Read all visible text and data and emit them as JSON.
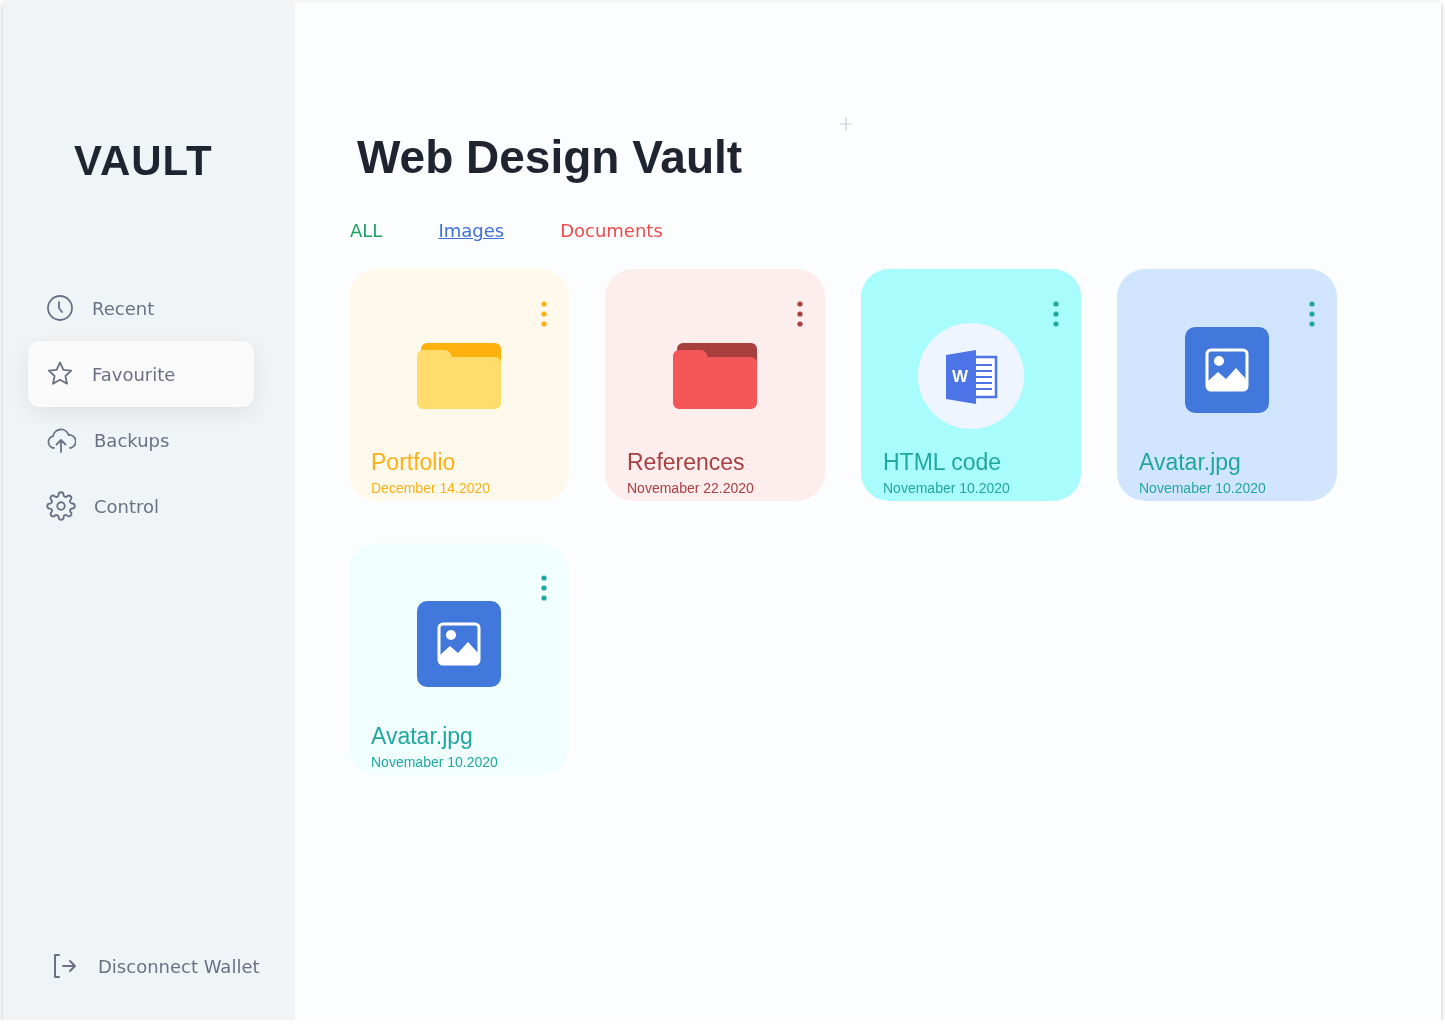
{
  "sidebar": {
    "brand": "VAULT",
    "items": [
      {
        "label": "Recent",
        "selected": false
      },
      {
        "label": "Favourite",
        "selected": true
      },
      {
        "label": "Backups",
        "selected": false
      },
      {
        "label": "Control",
        "selected": false
      }
    ],
    "footer": {
      "label": "Disconnect Wallet"
    }
  },
  "main": {
    "title": "Web Design Vault",
    "tabs": [
      {
        "label": "ALL",
        "color": "#1fa463",
        "selected": false
      },
      {
        "label": "Images",
        "color": "#3f6fd8",
        "selected": true
      },
      {
        "label": "Documents",
        "color": "#ef4b4b",
        "selected": false
      }
    ],
    "files": [
      {
        "kind": "folder",
        "name": "Portfolio",
        "date": "December 14.2020",
        "color": "#fbb016"
      },
      {
        "kind": "folder",
        "name": "References",
        "date": "Novemaber 22.2020",
        "color": "#a93f3f"
      },
      {
        "kind": "word",
        "name": "HTML code",
        "date": "Novemaber 10.2020",
        "color": "#22a6a0",
        "icon_letter": "W"
      },
      {
        "kind": "image",
        "name": "Avatar.jpg",
        "date": "Novemaber 10.2020",
        "color": "#22a6a0"
      },
      {
        "kind": "image",
        "name": "Avatar.jpg",
        "date": "Novemaber 10.2020",
        "color": "#22a6a0"
      }
    ]
  }
}
